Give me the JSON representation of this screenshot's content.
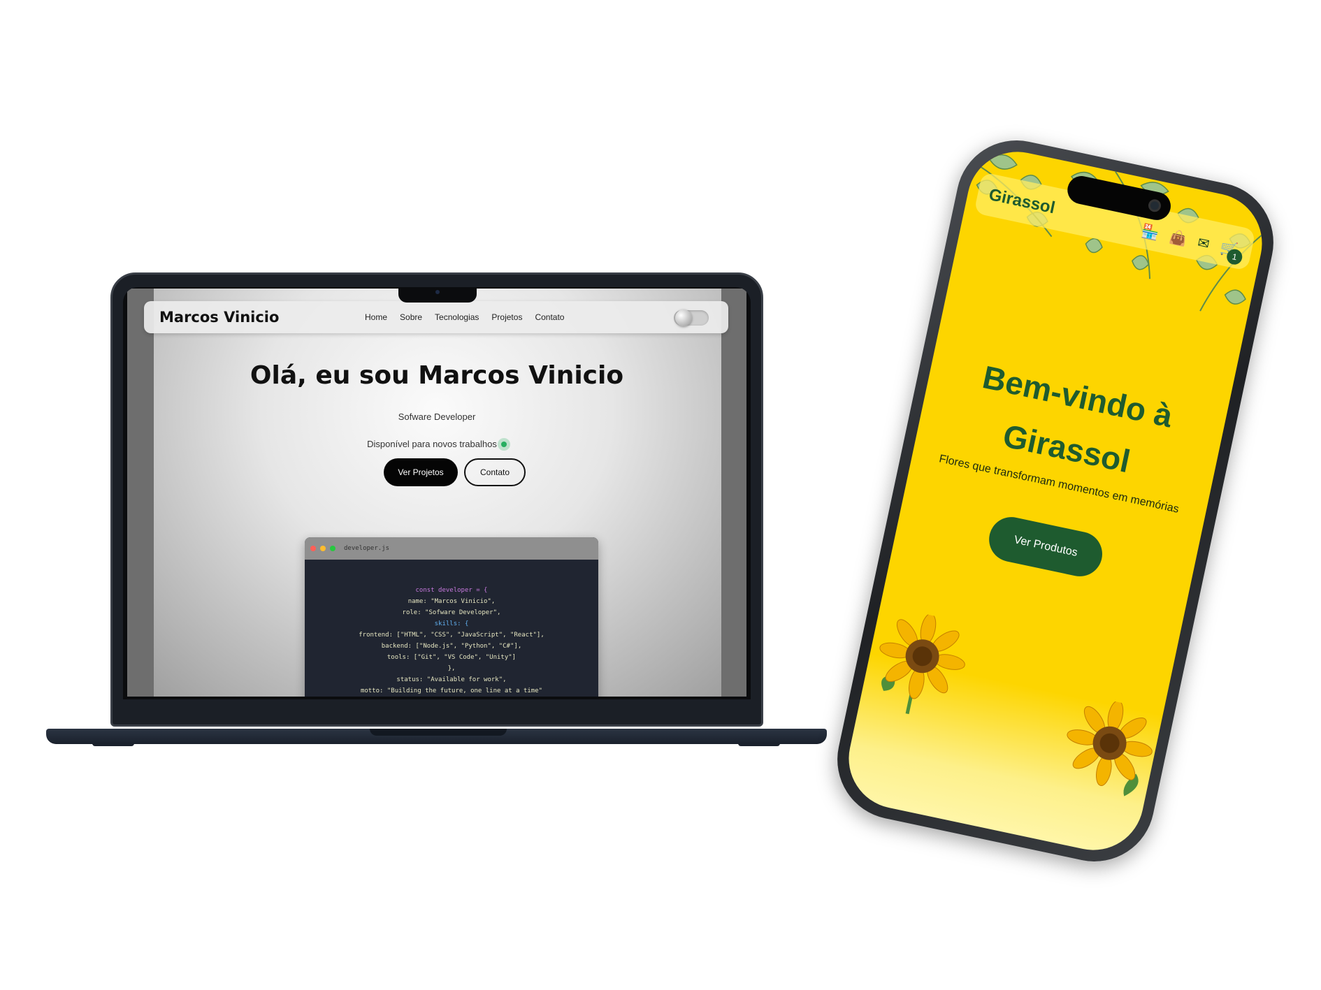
{
  "laptop_site": {
    "brand": "Marcos Vinicio",
    "nav": [
      "Home",
      "Sobre",
      "Tecnologias",
      "Projetos",
      "Contato"
    ],
    "hero_title": "Olá, eu sou Marcos Vinicio",
    "hero_subtitle": "Sofware Developer",
    "availability": "Disponível para novos trabalhos",
    "primary_button": "Ver Projetos",
    "secondary_button": "Contato",
    "code_window": {
      "filename": "developer.js",
      "lines": [
        "const developer = {",
        "name: \"Marcos Vinicio\",",
        "role: \"Sofware Developer\",",
        "skills: {",
        "frontend: [\"HTML\", \"CSS\", \"JavaScript\", \"React\"],",
        "backend: [\"Node.js\", \"Python\", \"C#\"],",
        "tools: [\"Git\", \"VS Code\", \"Unity\"]",
        "},",
        "status: \"Available for work\",",
        "motto: \"Building the future, one line at a time\""
      ]
    }
  },
  "phone_site": {
    "brand": "Girassol",
    "icons": [
      "store-icon",
      "bag-icon",
      "mail-icon",
      "cart-icon"
    ],
    "cart_count": "1",
    "hero_title_line1": "Bem-vindo à",
    "hero_title_line2": "Girassol",
    "tagline": "Flores que transformam momentos em memórias",
    "button": "Ver Produtos"
  },
  "colors": {
    "phone_background": "#fdd500",
    "phone_accent": "#1e5b2f",
    "availability_dot": "#27ae60"
  }
}
